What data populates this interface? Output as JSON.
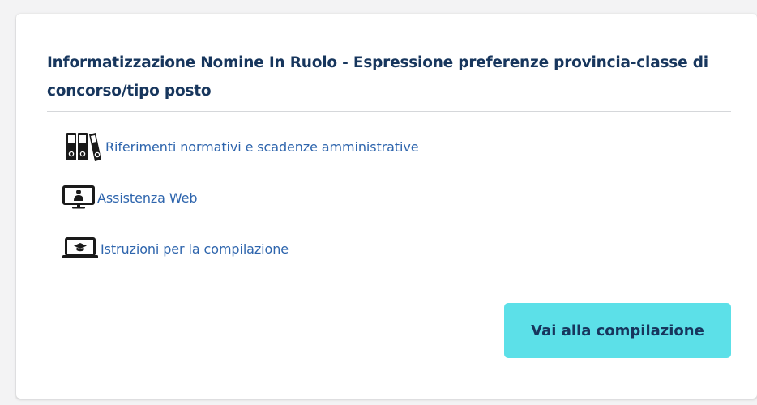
{
  "card": {
    "title": "Informatizzazione Nomine In Ruolo - Espressione preferenze provincia-classe di concorso/tipo posto",
    "links": [
      {
        "label": "Riferimenti normativi e scadenze amministrative",
        "icon": "binders-icon"
      },
      {
        "label": "Assistenza Web",
        "icon": "monitor-person-icon"
      },
      {
        "label": "Istruzioni per la compilazione",
        "icon": "laptop-graduation-cap-icon"
      }
    ],
    "cta_label": "Vai alla compilazione"
  },
  "colors": {
    "title": "#17365d",
    "link": "#2e65ad",
    "button_bg": "#5ce0e8",
    "divider": "#d5d7da"
  }
}
